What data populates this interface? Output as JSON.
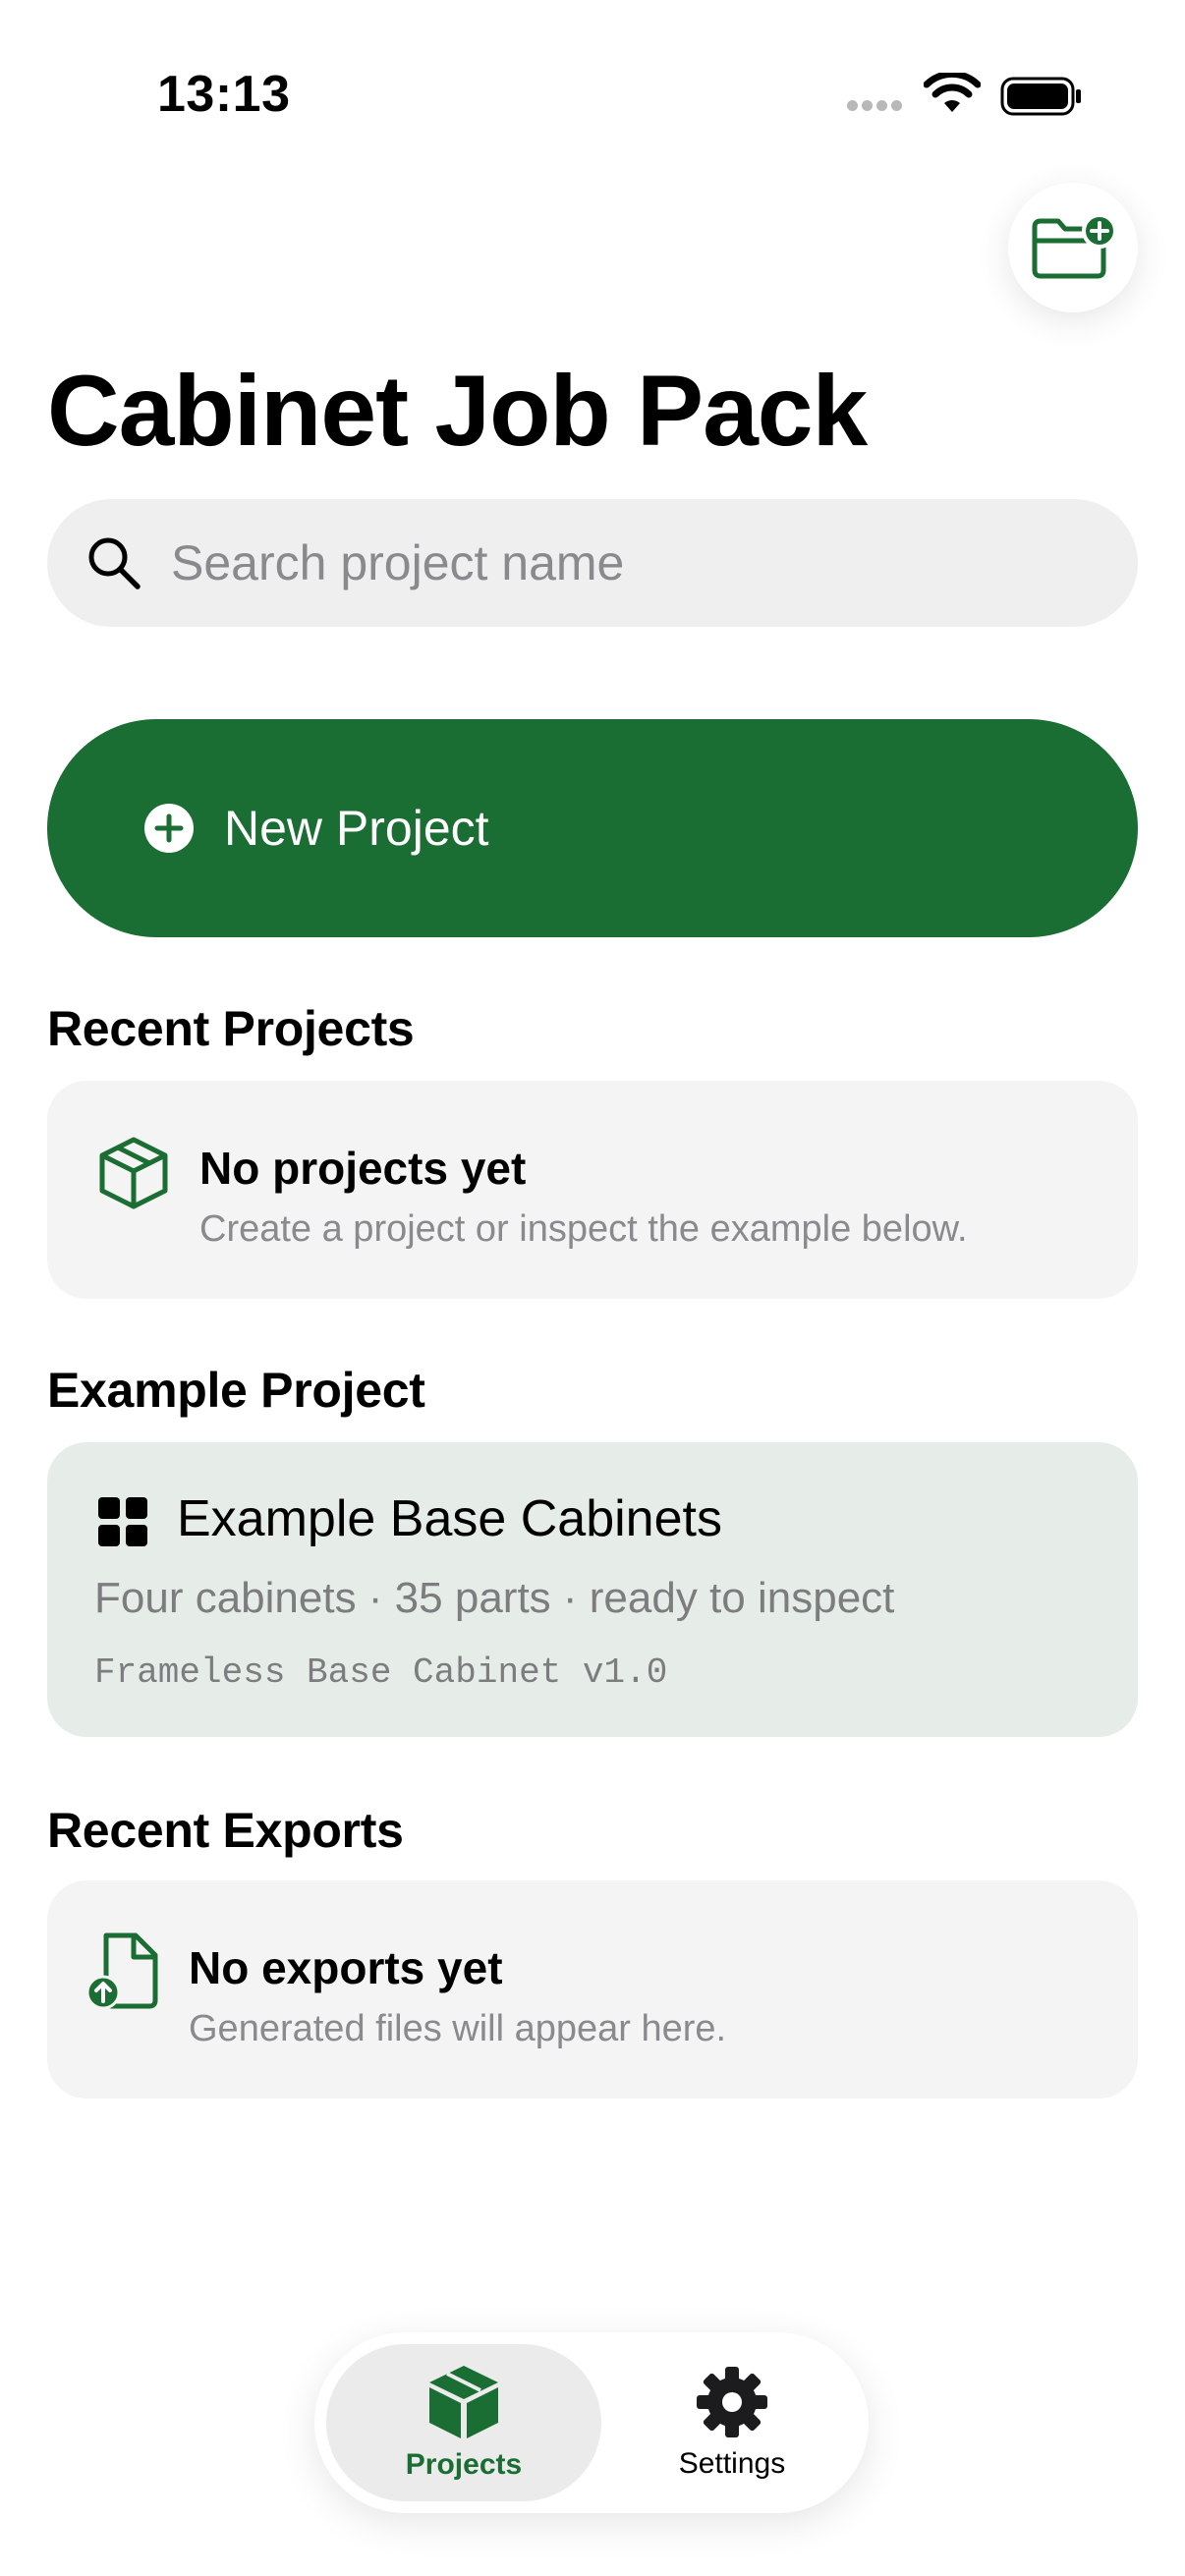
{
  "status_bar": {
    "time": "13:13"
  },
  "header": {
    "title": "Cabinet Job Pack",
    "add_folder_icon": "folder-plus-icon"
  },
  "search": {
    "placeholder": "Search project name",
    "value": ""
  },
  "new_project": {
    "label": "New Project",
    "icon": "plus-circle-icon"
  },
  "recent_projects": {
    "title": "Recent Projects",
    "empty_title": "No projects yet",
    "empty_subtitle": "Create a project or inspect the example below.",
    "icon": "box-icon"
  },
  "example_project": {
    "title": "Example Project",
    "card_title": "Example Base Cabinets",
    "card_description": "Four cabinets · 35 parts · ready to inspect",
    "card_template": "Frameless Base Cabinet v1.0",
    "icon": "grid-icon"
  },
  "recent_exports": {
    "title": "Recent Exports",
    "empty_title": "No exports yet",
    "empty_subtitle": "Generated files will appear here.",
    "icon": "file-upload-icon"
  },
  "tabs": [
    {
      "label": "Projects",
      "icon": "box-icon",
      "selected": true
    },
    {
      "label": "Settings",
      "icon": "gear-icon",
      "selected": false
    }
  ],
  "colors": {
    "accent": "#1b6e33",
    "example_card_bg": "#e6ede8",
    "card_bg": "#f4f4f4",
    "search_bg": "#efefef"
  }
}
